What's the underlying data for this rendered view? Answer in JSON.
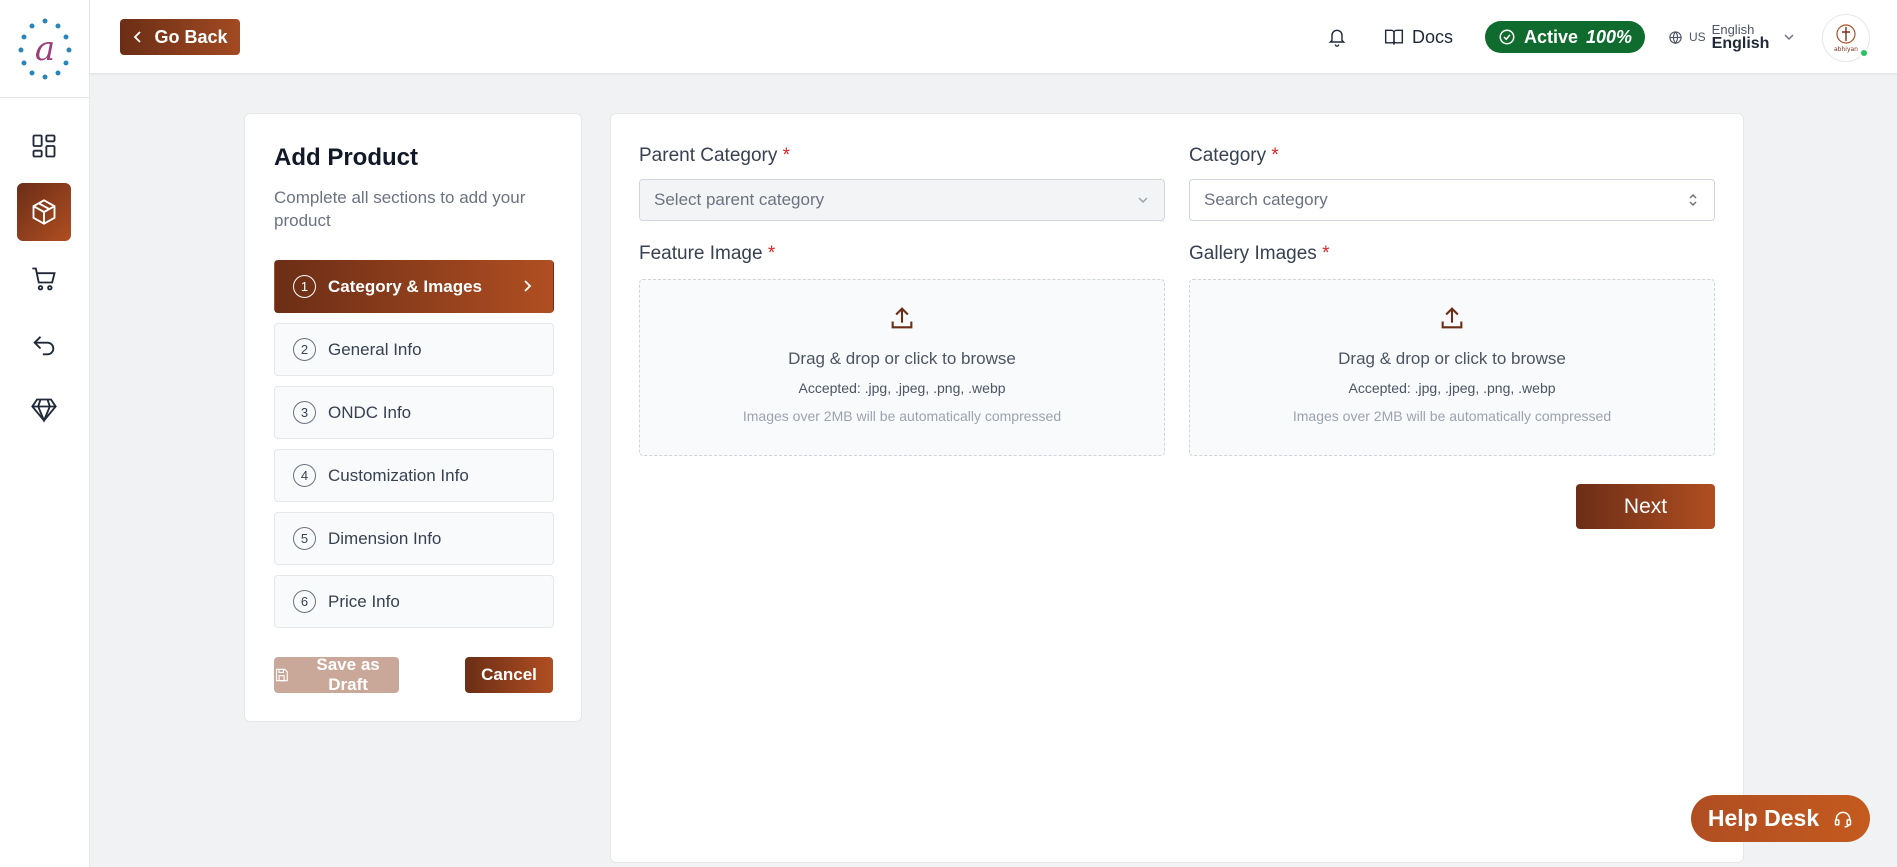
{
  "sidebar": {
    "logo": "a",
    "items": [
      {
        "name": "dashboard",
        "icon": "grid-icon"
      },
      {
        "name": "products",
        "icon": "box-icon",
        "active": true
      },
      {
        "name": "orders",
        "icon": "cart-icon"
      },
      {
        "name": "returns",
        "icon": "return-icon"
      },
      {
        "name": "premium",
        "icon": "diamond-icon"
      }
    ]
  },
  "topbar": {
    "go_back": "Go Back",
    "docs": "Docs",
    "status": "Active",
    "status_pct": "100%",
    "lang_code": "US",
    "lang_small": "English",
    "lang_big": "English",
    "avatar_text": "abhiyan"
  },
  "steps_card": {
    "title": "Add Product",
    "subtitle": "Complete all sections to add your product",
    "steps": [
      {
        "num": "1",
        "label": "Category & Images",
        "active": true
      },
      {
        "num": "2",
        "label": "General Info"
      },
      {
        "num": "3",
        "label": "ONDC Info"
      },
      {
        "num": "4",
        "label": "Customization Info"
      },
      {
        "num": "5",
        "label": "Dimension Info"
      },
      {
        "num": "6",
        "label": "Price Info"
      }
    ],
    "save_draft": "Save as Draft",
    "cancel": "Cancel"
  },
  "form": {
    "parent_category_label": "Parent Category",
    "parent_category_placeholder": "Select parent category",
    "category_label": "Category",
    "category_placeholder": "Search category",
    "feature_image_label": "Feature Image",
    "gallery_images_label": "Gallery Images",
    "required_mark": "*",
    "drop_text": "Drag & drop or click to browse",
    "accepted_text": "Accepted: .jpg, .jpeg, .png, .webp",
    "compress_note": "Images over 2MB will be automatically compressed",
    "next": "Next"
  },
  "help_desk": "Help Desk",
  "colors": {
    "brand_dark": "#6b2e16",
    "brand_light": "#b04e22",
    "active_green": "#0f6b2e",
    "required_red": "#dc2626"
  }
}
